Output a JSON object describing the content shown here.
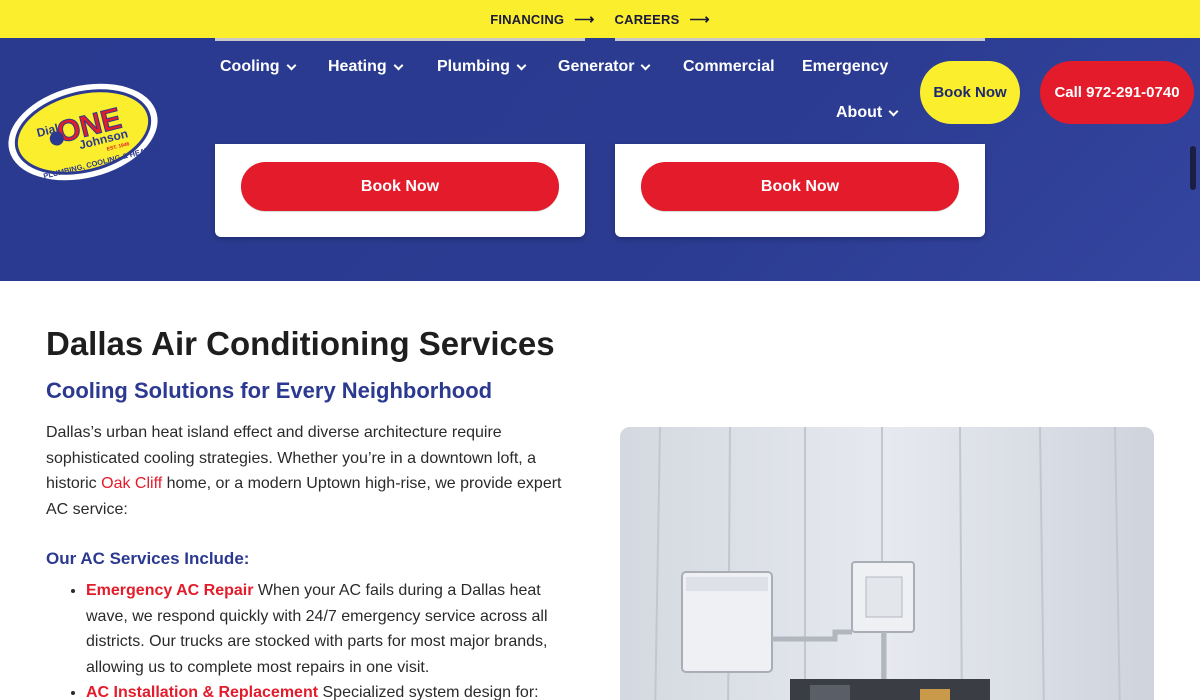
{
  "topbar": {
    "financing_label": "FINANCING",
    "careers_label": "CAREERS",
    "arrow_icon": "arrow-right-icon"
  },
  "logo": {
    "text_dial": "Dial",
    "text_one": "ONE",
    "text_johnson": "Johnson",
    "text_est": "EST. 1946",
    "text_tagline": "PLUMBING, COOLING & HEATING"
  },
  "nav": {
    "items": [
      {
        "label": "Cooling",
        "has_dropdown": true
      },
      {
        "label": "Heating",
        "has_dropdown": true
      },
      {
        "label": "Plumbing",
        "has_dropdown": true
      },
      {
        "label": "Generator",
        "has_dropdown": true
      },
      {
        "label": "Commercial",
        "has_dropdown": false
      },
      {
        "label": "Emergency",
        "has_dropdown": false
      },
      {
        "label": "About",
        "has_dropdown": true
      }
    ],
    "book_now_label": "Book Now",
    "call_label": "Call 972-291-0740"
  },
  "hero_cards": [
    {
      "button_label": "Book Now"
    },
    {
      "button_label": "Book Now"
    }
  ],
  "main": {
    "title": "Dallas Air Conditioning Services",
    "subtitle": "Cooling Solutions for Every Neighborhood",
    "intro_part1": "Dallas’s urban heat island effect and diverse architecture require sophisticated cooling strategies. Whether you’re in a downtown loft, a historic ",
    "intro_link": "Oak Cliff",
    "intro_part2": " home, or a modern Uptown high-rise, we provide expert AC service:",
    "services_heading": "Our AC Services Include:",
    "services": [
      {
        "title": "Emergency AC Repair",
        "text": " When your AC fails during a Dallas heat wave, we respond quickly with 24/7 emergency service across all districts. Our trucks are stocked with parts for most major brands, allowing us to complete most repairs in one visit."
      },
      {
        "title": "AC Installation & Replacement",
        "text": " Specialized system design for:"
      }
    ]
  },
  "colors": {
    "brand_blue": "#2b3990",
    "brand_red": "#e31b2b",
    "brand_yellow": "#fbee2c"
  }
}
